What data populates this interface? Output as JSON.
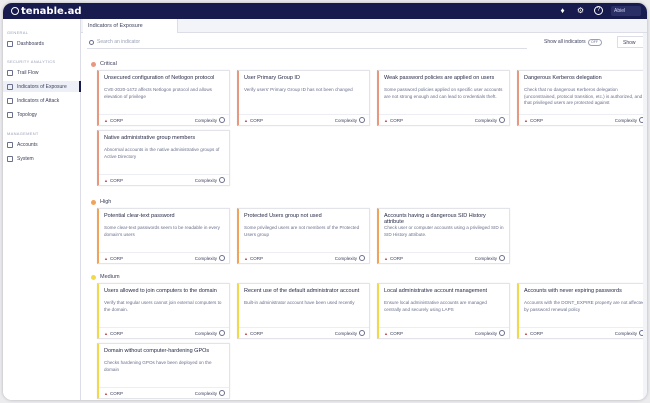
{
  "app": {
    "brand": "tenable.ad",
    "user": "Abiel"
  },
  "colors": {
    "topbar": "#171b4d",
    "critical": "#e8987f",
    "high": "#f0a45a",
    "medium": "#f2d94a"
  },
  "sidebar": {
    "section1": "GENERAL",
    "dashboards": "Dashboards",
    "section2": "SECURITY ANALYTICS",
    "trailflow": "Trail Flow",
    "ioe": "Indicators of Exposure",
    "ioa": "Indicators of Attack",
    "topology": "Topology",
    "section3": "MANAGEMENT",
    "accounts": "Accounts",
    "system": "System"
  },
  "tab": "Indicators of Exposure",
  "search": {
    "placeholder": "Search an indicator",
    "show_all": "Show all indicators",
    "toggle": "OFF",
    "show_btn": "Show"
  },
  "groups": {
    "critical": "Critical",
    "high": "High",
    "medium": "Medium"
  },
  "card_common": {
    "domain": "CORP",
    "complexity": "Complexity"
  },
  "critical_cards": [
    {
      "title": "Unsecured configuration of Netlogon protocol",
      "desc": "CVE-2020-1472 affects Netlogon protocol and allows elevation of privilege"
    },
    {
      "title": "User Primary Group ID",
      "desc": "Verify users' Primary Group ID has not been changed"
    },
    {
      "title": "Weak password policies are applied on users",
      "desc": "Some password policies applied on specific user accounts are not strong enough and can lead to credentials theft."
    },
    {
      "title": "Dangerous Kerberos delegation",
      "desc": "Check that no dangerous Kerberos delegation (unconstrained, protocol transition, etc.) is authorized, and that privileged users are protected against"
    },
    {
      "title": "Native administrative group members",
      "desc": "Abnormal accounts in the native administrative groups of Active Directory"
    }
  ],
  "high_cards": [
    {
      "title": "Potential clear-text password",
      "desc": "Some clear-text passwords seem to be readable in every domain's users"
    },
    {
      "title": "Protected Users group not used",
      "desc": "Some privileged users are not members of the Protected Users group"
    },
    {
      "title": "Accounts having a dangerous SID History attribute",
      "desc": "Check user or computer accounts using a privileged SID in SID History attribute."
    }
  ],
  "medium_cards": [
    {
      "title": "Users allowed to join computers to the domain",
      "desc": "Verify that regular users cannot join external computers to the domain."
    },
    {
      "title": "Recent use of the default administrator account",
      "desc": "Built-in administrator account have been used recently"
    },
    {
      "title": "Local administrative account management",
      "desc": "Ensure local administrative accounts are managed centrally and securely using LAPS"
    },
    {
      "title": "Accounts with never expiring passwords",
      "desc": "Accounts with the DONT_EXPIRE property are not affected by password renewal policy"
    },
    {
      "title": "Domain without computer-hardening GPOs",
      "desc": "Checks hardening GPOs have been deployed on the domain"
    }
  ]
}
